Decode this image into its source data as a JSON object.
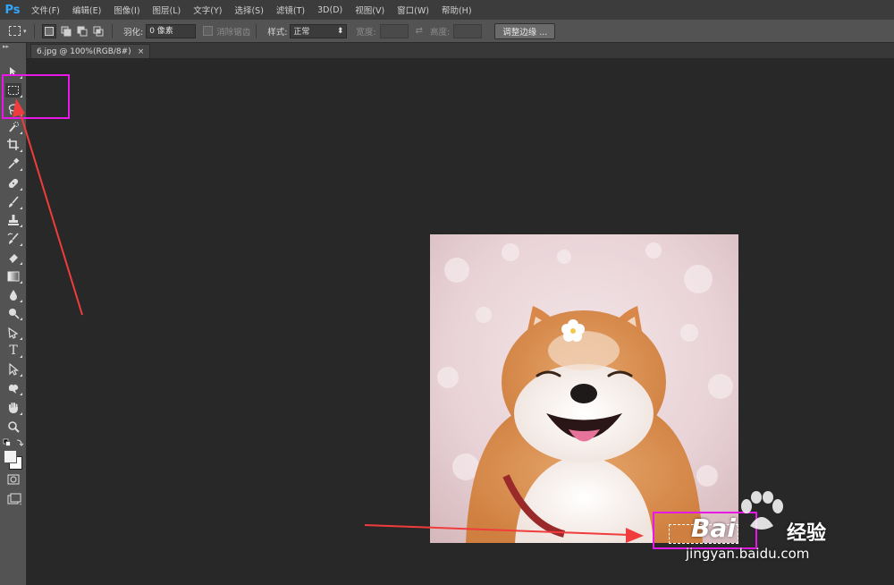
{
  "app": {
    "logo": "Ps"
  },
  "menu": [
    "文件(F)",
    "编辑(E)",
    "图像(I)",
    "图层(L)",
    "文字(Y)",
    "选择(S)",
    "滤镜(T)",
    "3D(D)",
    "视图(V)",
    "窗口(W)",
    "帮助(H)"
  ],
  "options": {
    "feather_label": "羽化:",
    "feather_value": "0 像素",
    "antialias_label": "消除锯齿",
    "style_label": "样式:",
    "style_value": "正常",
    "width_label": "宽度:",
    "height_label": "高度:",
    "refine_button": "调整边缘 ..."
  },
  "document": {
    "tab_title": "6.jpg @ 100%(RGB/8#)",
    "close_glyph": "×"
  },
  "toolbar": {
    "tools": [
      "move-tool",
      "rectangular-marquee-tool",
      "lasso-tool",
      "quick-selection-tool",
      "crop-tool",
      "eyedropper-tool",
      "spot-healing-tool",
      "brush-tool",
      "clone-stamp-tool",
      "history-brush-tool",
      "eraser-tool",
      "gradient-tool",
      "blur-tool",
      "dodge-tool",
      "pen-tool",
      "type-tool",
      "path-selection-tool",
      "shape-tool",
      "hand-tool",
      "zoom-tool"
    ],
    "type_glyph": "T"
  },
  "watermark": {
    "brand": "Bai",
    "brand2": "经验",
    "url": "jingyan.baidu.com"
  },
  "colors": {
    "highlight": "#e619e6",
    "arrow": "#f03c3c",
    "ps_blue": "#31a8ff"
  }
}
